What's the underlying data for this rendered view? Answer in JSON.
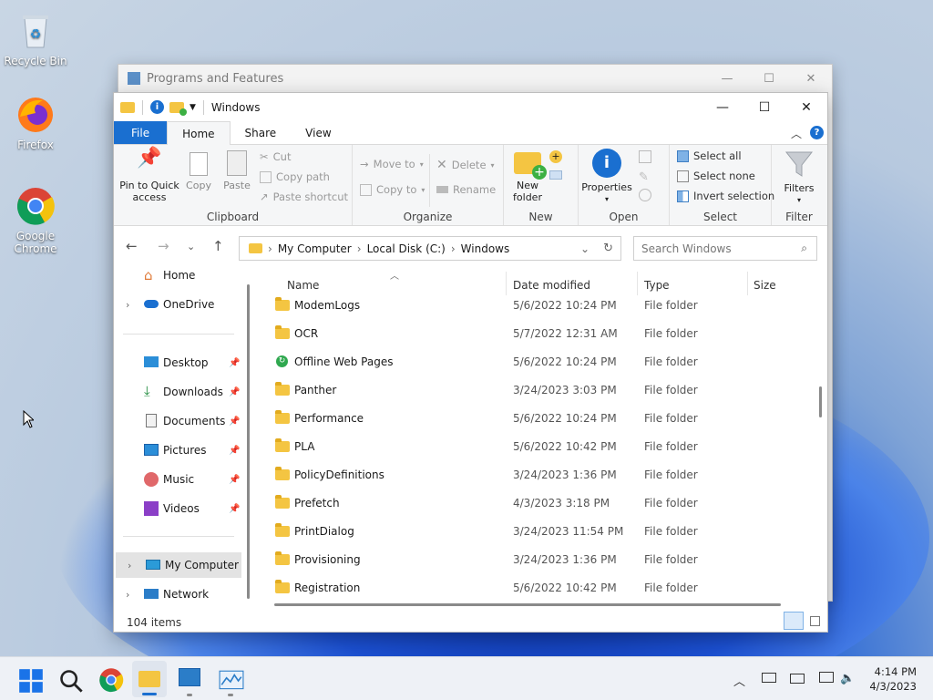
{
  "desktop": {
    "icons": [
      {
        "label": "Recycle Bin"
      },
      {
        "label": "Firefox"
      },
      {
        "label": "Google Chrome"
      }
    ]
  },
  "bg_window": {
    "title": "Programs and Features"
  },
  "explorer": {
    "title": "Windows",
    "menu_tabs": [
      "File",
      "Home",
      "Share",
      "View"
    ],
    "ribbon": {
      "clipboard": {
        "label": "Clipboard",
        "pin": "Pin to Quick access",
        "copy": "Copy",
        "paste": "Paste",
        "cut": "Cut",
        "copy_path": "Copy path",
        "paste_shortcut": "Paste shortcut"
      },
      "organize": {
        "label": "Organize",
        "move_to": "Move to",
        "copy_to": "Copy to",
        "delete": "Delete",
        "rename": "Rename"
      },
      "new": {
        "label": "New",
        "new_folder": "New folder"
      },
      "open": {
        "label": "Open",
        "properties": "Properties"
      },
      "select": {
        "label": "Select",
        "select_all": "Select all",
        "select_none": "Select none",
        "invert": "Invert selection"
      },
      "filter": {
        "label": "Filter",
        "filters": "Filters"
      }
    },
    "address": {
      "crumbs": [
        "My Computer",
        "Local Disk (C:)",
        "Windows"
      ],
      "search_placeholder": "Search Windows"
    },
    "nav_pane": {
      "home": "Home",
      "onedrive": "OneDrive",
      "quick": [
        "Desktop",
        "Downloads",
        "Documents",
        "Pictures",
        "Music",
        "Videos"
      ],
      "my_computer": "My Computer",
      "network": "Network"
    },
    "columns": [
      "Name",
      "Date modified",
      "Type",
      "Size"
    ],
    "files": [
      {
        "name": "ModemLogs",
        "date": "5/6/2022 10:24 PM",
        "type": "File folder"
      },
      {
        "name": "OCR",
        "date": "5/7/2022 12:31 AM",
        "type": "File folder"
      },
      {
        "name": "Offline Web Pages",
        "date": "5/6/2022 10:24 PM",
        "type": "File folder"
      },
      {
        "name": "Panther",
        "date": "3/24/2023 3:03 PM",
        "type": "File folder"
      },
      {
        "name": "Performance",
        "date": "5/6/2022 10:24 PM",
        "type": "File folder"
      },
      {
        "name": "PLA",
        "date": "5/6/2022 10:42 PM",
        "type": "File folder"
      },
      {
        "name": "PolicyDefinitions",
        "date": "3/24/2023 1:36 PM",
        "type": "File folder"
      },
      {
        "name": "Prefetch",
        "date": "4/3/2023 3:18 PM",
        "type": "File folder"
      },
      {
        "name": "PrintDialog",
        "date": "3/24/2023 11:54 PM",
        "type": "File folder"
      },
      {
        "name": "Provisioning",
        "date": "3/24/2023 1:36 PM",
        "type": "File folder"
      },
      {
        "name": "Registration",
        "date": "5/6/2022 10:42 PM",
        "type": "File folder"
      }
    ],
    "status": "104 items"
  },
  "taskbar": {
    "time": "4:14 PM",
    "date": "4/3/2023"
  },
  "colors": {
    "accent": "#1a6fd0",
    "folder": "#f4c542"
  }
}
